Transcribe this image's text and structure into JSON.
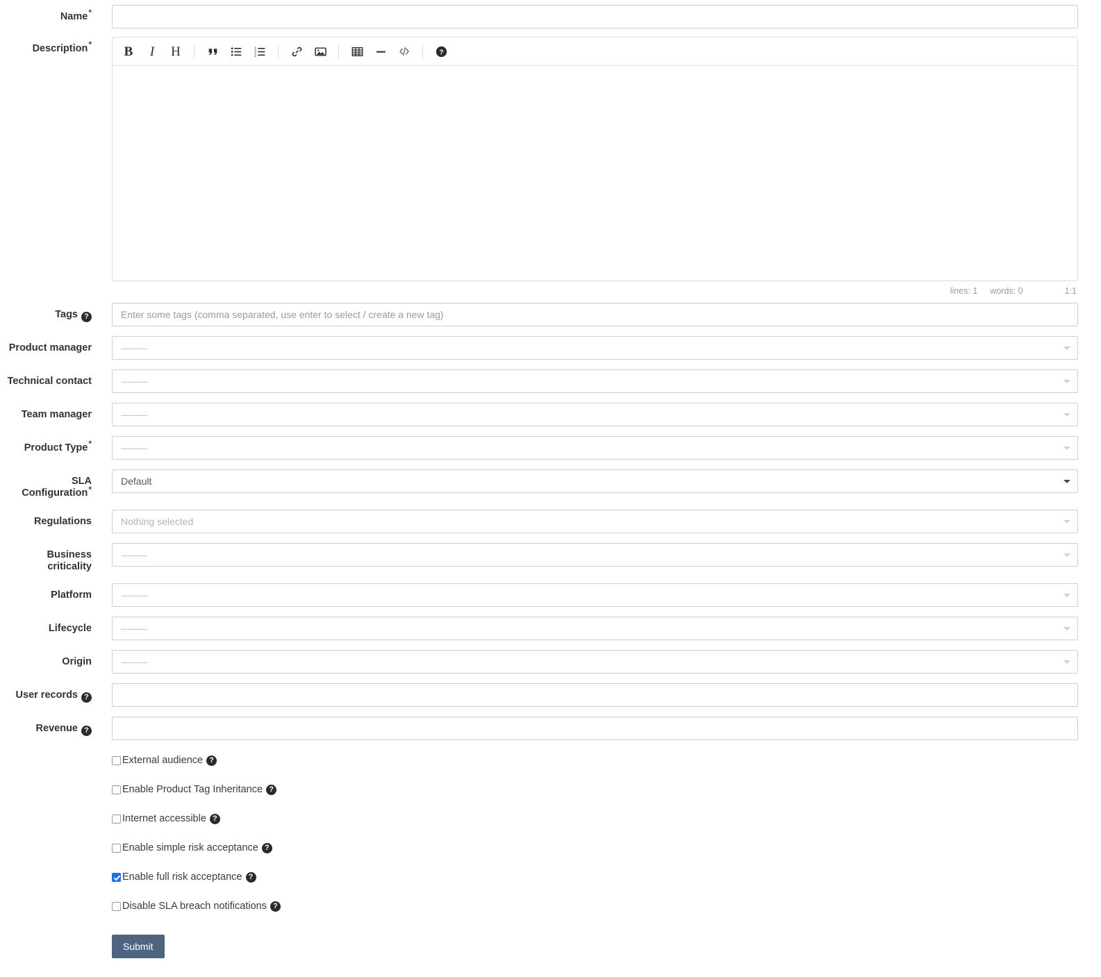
{
  "form": {
    "fields": {
      "name": {
        "label": "Name",
        "required": true,
        "value": "",
        "placeholder": ""
      },
      "description": {
        "label": "Description",
        "required": true,
        "value": "",
        "placeholder": ""
      },
      "tags": {
        "label": "Tags",
        "required": false,
        "has_help": true,
        "value": "",
        "placeholder": "Enter some tags (comma separated, use enter to select / create a new tag)"
      },
      "product_manager": {
        "label": "Product manager",
        "required": false,
        "value": "---------"
      },
      "technical_contact": {
        "label": "Technical contact",
        "required": false,
        "value": "---------"
      },
      "team_manager": {
        "label": "Team manager",
        "required": false,
        "value": "---------"
      },
      "product_type": {
        "label": "Product Type",
        "required": true,
        "value": "---------"
      },
      "sla_configuration": {
        "label": "SLA Configuration",
        "required": true,
        "value": "Default"
      },
      "regulations": {
        "label": "Regulations",
        "required": false,
        "value": "Nothing selected"
      },
      "business_criticality": {
        "label": "Business criticality",
        "required": false,
        "value": "---------"
      },
      "platform": {
        "label": "Platform",
        "required": false,
        "value": "---------"
      },
      "lifecycle": {
        "label": "Lifecycle",
        "required": false,
        "value": "---------"
      },
      "origin": {
        "label": "Origin",
        "required": false,
        "value": "---------"
      },
      "user_records": {
        "label": "User records",
        "required": false,
        "has_help": true,
        "value": "",
        "placeholder": ""
      },
      "revenue": {
        "label": "Revenue",
        "required": false,
        "has_help": true,
        "value": "",
        "placeholder": ""
      }
    },
    "editor": {
      "toolbar": [
        {
          "name": "bold",
          "glyph": "B"
        },
        {
          "name": "italic",
          "glyph": "I"
        },
        {
          "name": "heading",
          "glyph": "H"
        },
        {
          "name": "quote",
          "glyph": "“"
        },
        {
          "name": "unordered-list",
          "glyph": "☰"
        },
        {
          "name": "ordered-list",
          "glyph": "☰"
        },
        {
          "name": "link",
          "glyph": "🔗"
        },
        {
          "name": "image",
          "glyph": "🖼"
        },
        {
          "name": "table",
          "glyph": "▦"
        },
        {
          "name": "horizontal-rule",
          "glyph": "—"
        },
        {
          "name": "code",
          "glyph": "</>"
        },
        {
          "name": "markdown-guide",
          "glyph": "?"
        }
      ],
      "status": {
        "lines": "lines: 1",
        "words": "words: 0",
        "cursor": "1:1"
      }
    },
    "checkboxes": [
      {
        "name": "external-audience",
        "label": "External audience",
        "checked": false,
        "has_help": true
      },
      {
        "name": "enable-product-tag-inheritance",
        "label": "Enable Product Tag Inheritance",
        "checked": false,
        "has_help": true
      },
      {
        "name": "internet-accessible",
        "label": "Internet accessible",
        "checked": false,
        "has_help": true
      },
      {
        "name": "enable-simple-risk-acceptance",
        "label": "Enable simple risk acceptance",
        "checked": false,
        "has_help": true
      },
      {
        "name": "enable-full-risk-acceptance",
        "label": "Enable full risk acceptance",
        "checked": true,
        "has_help": true
      },
      {
        "name": "disable-sla-breach-notifications",
        "label": "Disable SLA breach notifications",
        "checked": false,
        "has_help": true
      }
    ],
    "submit": {
      "label": "Submit"
    },
    "help_icon_glyph": "?",
    "required_marker": "*"
  },
  "colors": {
    "submit_background": "#4e6481",
    "checkbox_checked": "#1a73e8",
    "required_asterisk": "#2b4a78",
    "input_border": "#cccccc",
    "placeholder_text": "#9a9a9a",
    "status_text": "#9b9b9b"
  }
}
